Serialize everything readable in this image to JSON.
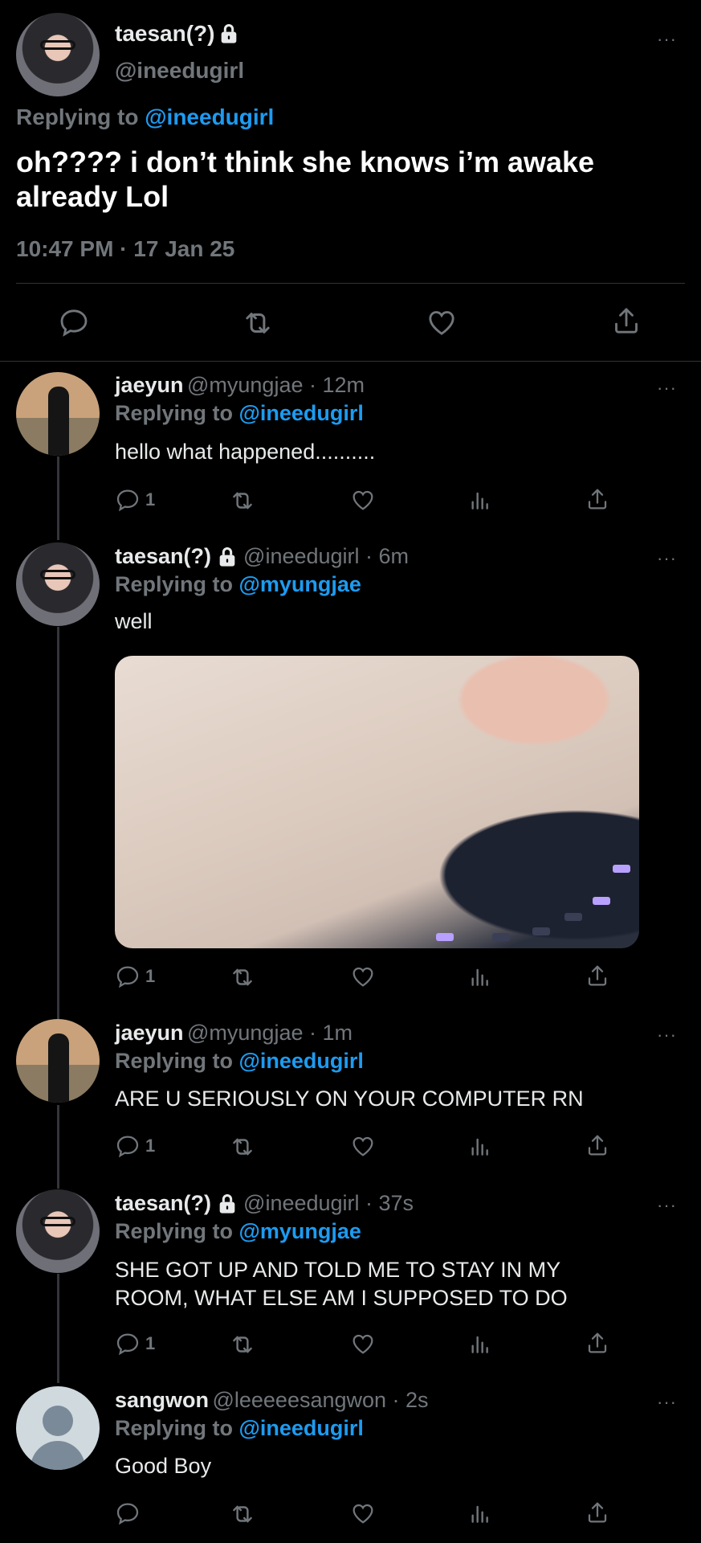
{
  "main_tweet": {
    "name": "taesan(?)",
    "handle": "@ineedugirl",
    "replying_prefix": "Replying to",
    "replying_to": "@ineedugirl",
    "text_line1": "oh???? i don’t think she knows i’m awake",
    "text_line2": "already Lol",
    "timestamp": "10:47 PM · 17 Jan 25",
    "more": "···"
  },
  "replies": [
    {
      "name": "jaeyun",
      "handle": "@myungjae · 12m",
      "replying_prefix": "Replying to",
      "replying_to": "@ineedugirl",
      "text": "hello what happened..........",
      "reply_count": "1"
    },
    {
      "name": "taesan(?)",
      "handle": "@ineedugirl · 6m",
      "replying_prefix": "Replying to",
      "replying_to": "@myungjae",
      "text": "well",
      "reply_count": "1"
    },
    {
      "name": "jaeyun",
      "handle": "@myungjae · 1m",
      "replying_prefix": "Replying to",
      "replying_to": "@ineedugirl",
      "text": "ARE U SERIOUSLY ON YOUR COMPUTER RN",
      "reply_count": "1"
    },
    {
      "name": "taesan(?)",
      "handle": "@ineedugirl · 37s",
      "replying_prefix": "Replying to",
      "replying_to": "@myungjae",
      "text_line1": "SHE GOT UP AND TOLD ME TO STAY IN MY",
      "text_line2": "ROOM, WHAT ELSE AM I SUPPOSED TO DO",
      "reply_count": "1"
    },
    {
      "name": "sangwon",
      "handle": "@leeeeesangwon · 2s",
      "replying_prefix": "Replying to",
      "replying_to": "@ineedugirl",
      "text": "Good Boy",
      "reply_count": ""
    }
  ],
  "icons": [
    "reply-icon",
    "retweet-icon",
    "like-icon",
    "views-icon",
    "share-icon",
    "lock-icon",
    "more-icon"
  ],
  "colors": {
    "background": "#000000",
    "text": "#e7e9ea",
    "muted": "#71767b",
    "link": "#1d9bf0",
    "divider": "#2f3336"
  }
}
